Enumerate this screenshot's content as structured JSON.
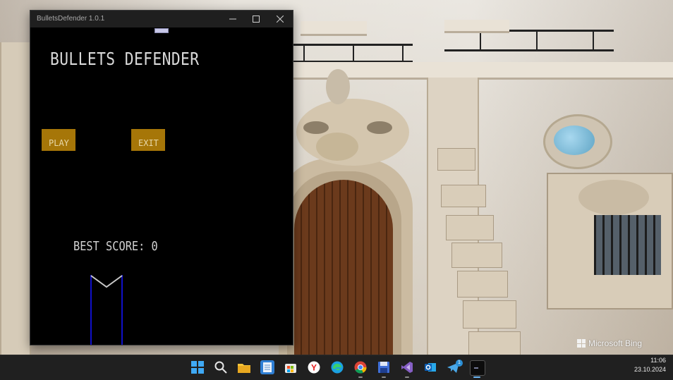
{
  "window": {
    "title": "BulletsDefender 1.0.1",
    "minimize_icon": "minimize-icon",
    "maximize_icon": "maximize-icon",
    "close_icon": "close-icon"
  },
  "game": {
    "title": "BULLETS DEFENDER",
    "play_label": "PLAY",
    "exit_label": "EXIT",
    "best_score_label": "BEST SCORE: 0",
    "colors": {
      "background": "#000000",
      "button": "#a67608",
      "cannon": "#1010c8",
      "text": "#d0d0d0"
    }
  },
  "wallpaper": {
    "brand": "Microsoft Bing"
  },
  "taskbar": {
    "icons": [
      {
        "name": "windows-start-icon"
      },
      {
        "name": "search-icon"
      },
      {
        "name": "file-explorer-icon"
      },
      {
        "name": "notepad-icon"
      },
      {
        "name": "microsoft-store-icon"
      },
      {
        "name": "yandex-browser-icon"
      },
      {
        "name": "edge-icon"
      },
      {
        "name": "chrome-icon"
      },
      {
        "name": "floppy-save-icon"
      },
      {
        "name": "visual-studio-icon"
      },
      {
        "name": "outlook-icon"
      },
      {
        "name": "telegram-icon",
        "badge": "1"
      },
      {
        "name": "terminal-app-icon"
      }
    ],
    "time": "11:06",
    "date": "23.10.2024"
  }
}
